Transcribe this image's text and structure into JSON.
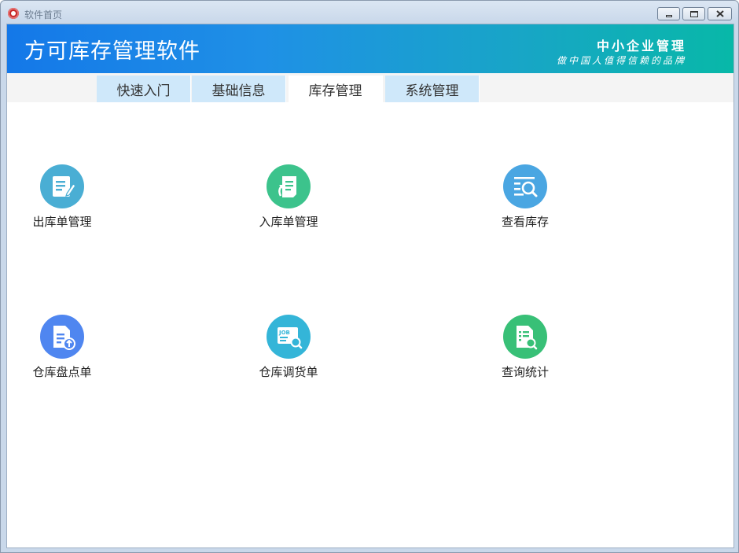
{
  "window": {
    "title": "软件首页",
    "controls": {
      "minimize": "minimize",
      "restore": "restore",
      "close": "close"
    }
  },
  "banner": {
    "title": "方可库存管理软件",
    "slogan_main": "中小企业管理",
    "slogan_sub": "做中国人值得信赖的品牌"
  },
  "tabs": [
    {
      "label": "快速入门",
      "active": false
    },
    {
      "label": "基础信息",
      "active": false
    },
    {
      "label": "库存管理",
      "active": true
    },
    {
      "label": "系统管理",
      "active": false
    }
  ],
  "tiles": [
    {
      "label": "出库单管理",
      "icon": "edit-document-icon",
      "color": "#4aaed4"
    },
    {
      "label": "入库单管理",
      "icon": "inbound-document-icon",
      "color": "#3cc38c"
    },
    {
      "label": "查看库存",
      "icon": "search-list-icon",
      "color": "#4aa6e2"
    },
    {
      "label": "仓库盘点单",
      "icon": "upload-document-icon",
      "color": "#4f86f0"
    },
    {
      "label": "仓库调货单",
      "icon": "job-search-icon",
      "color": "#34b5d8"
    },
    {
      "label": "查询统计",
      "icon": "report-search-icon",
      "color": "#38c077"
    }
  ]
}
